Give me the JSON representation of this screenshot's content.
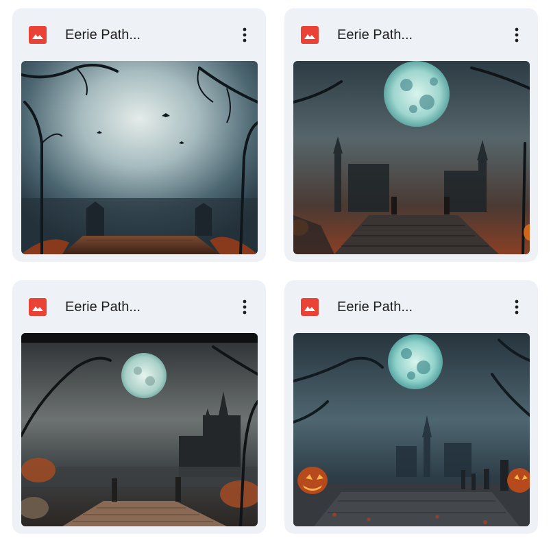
{
  "files": [
    {
      "title": "Eerie Path...",
      "type_icon": "image-file-icon",
      "menu_icon": "more-vert-icon",
      "thumbnail": "halloween-moon-wooden-path"
    },
    {
      "title": "Eerie Path...",
      "type_icon": "image-file-icon",
      "menu_icon": "more-vert-icon",
      "thumbnail": "halloween-blue-moon-castle-pumpkins"
    },
    {
      "title": "Eerie Path...",
      "type_icon": "image-file-icon",
      "menu_icon": "more-vert-icon",
      "thumbnail": "halloween-full-moon-castle-stone-path"
    },
    {
      "title": "Eerie Path...",
      "type_icon": "image-file-icon",
      "menu_icon": "more-vert-icon",
      "thumbnail": "halloween-blue-moon-graves-pumpkins"
    }
  ],
  "colors": {
    "card_bg": "#eef1f6",
    "icon_red": "#ea4335",
    "title_text": "#1f1f1f"
  }
}
